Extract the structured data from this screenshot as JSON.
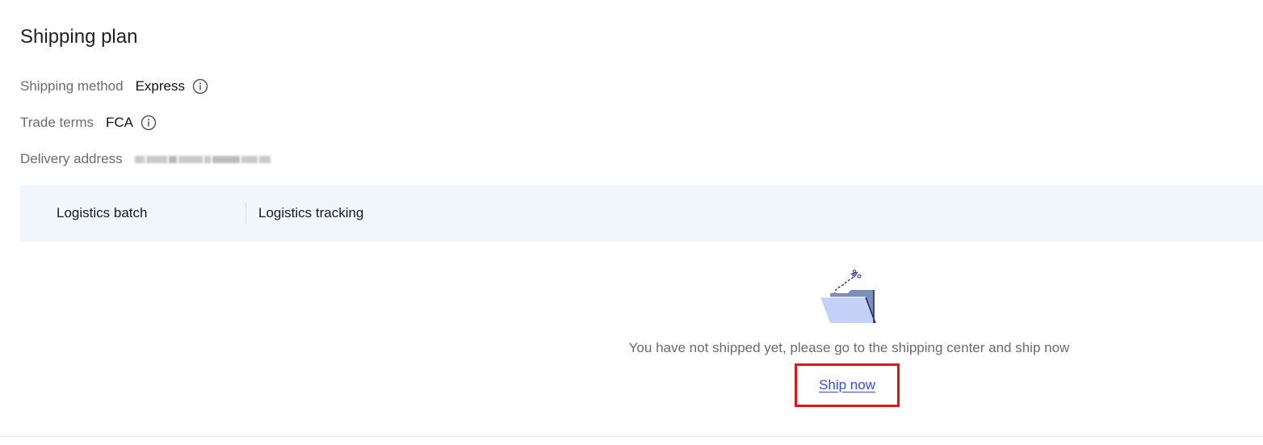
{
  "section": {
    "title": "Shipping plan"
  },
  "fields": {
    "shipping_method": {
      "label": "Shipping method",
      "value": "Express",
      "icon": "info-icon"
    },
    "trade_terms": {
      "label": "Trade terms",
      "value": "FCA",
      "icon": "info-icon"
    },
    "delivery_address": {
      "label": "Delivery address"
    }
  },
  "table": {
    "columns": [
      "Logistics batch",
      "Logistics tracking"
    ]
  },
  "empty_state": {
    "illustration": "empty-folder-illustration",
    "message": "You have not shipped yet, please go to the shipping center and ship now",
    "action_label": "Ship now"
  },
  "colors": {
    "header_bg": "#f1f6fd",
    "link": "#3a4cd4",
    "highlight_box": "#e01515",
    "label_gray": "#6b6b6b"
  }
}
